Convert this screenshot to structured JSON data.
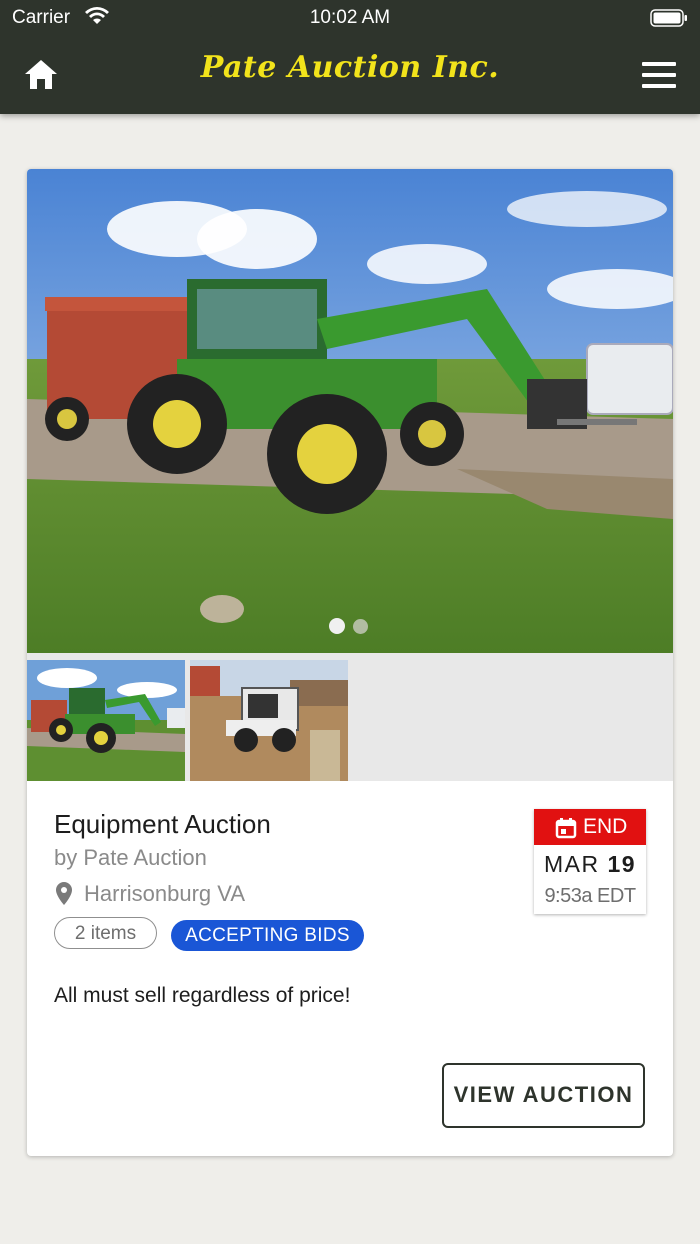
{
  "status_bar": {
    "carrier": "Carrier",
    "time": "10:02 AM"
  },
  "header": {
    "brand": "Pate Auction Inc.",
    "home_icon": "home-icon",
    "menu_icon": "hamburger-menu-icon",
    "colors": {
      "bar": "#2e342c",
      "brand": "#f2e31b"
    }
  },
  "auction": {
    "gallery": {
      "slide_count": 2,
      "active_slide": 1,
      "thumbnails": 2
    },
    "title": "Equipment Auction",
    "byline": "by Pate Auction",
    "location": "Harrisonburg VA",
    "items_badge": "2 items",
    "status_badge": "ACCEPTING BIDS",
    "description": "All must sell regardless of price!",
    "date": {
      "label": "END",
      "month": "MAR",
      "day": "19",
      "time": "9:53a EDT"
    },
    "view_button": "VIEW AUCTION",
    "colors": {
      "status": "#1a56d6",
      "end": "#e11111"
    }
  }
}
